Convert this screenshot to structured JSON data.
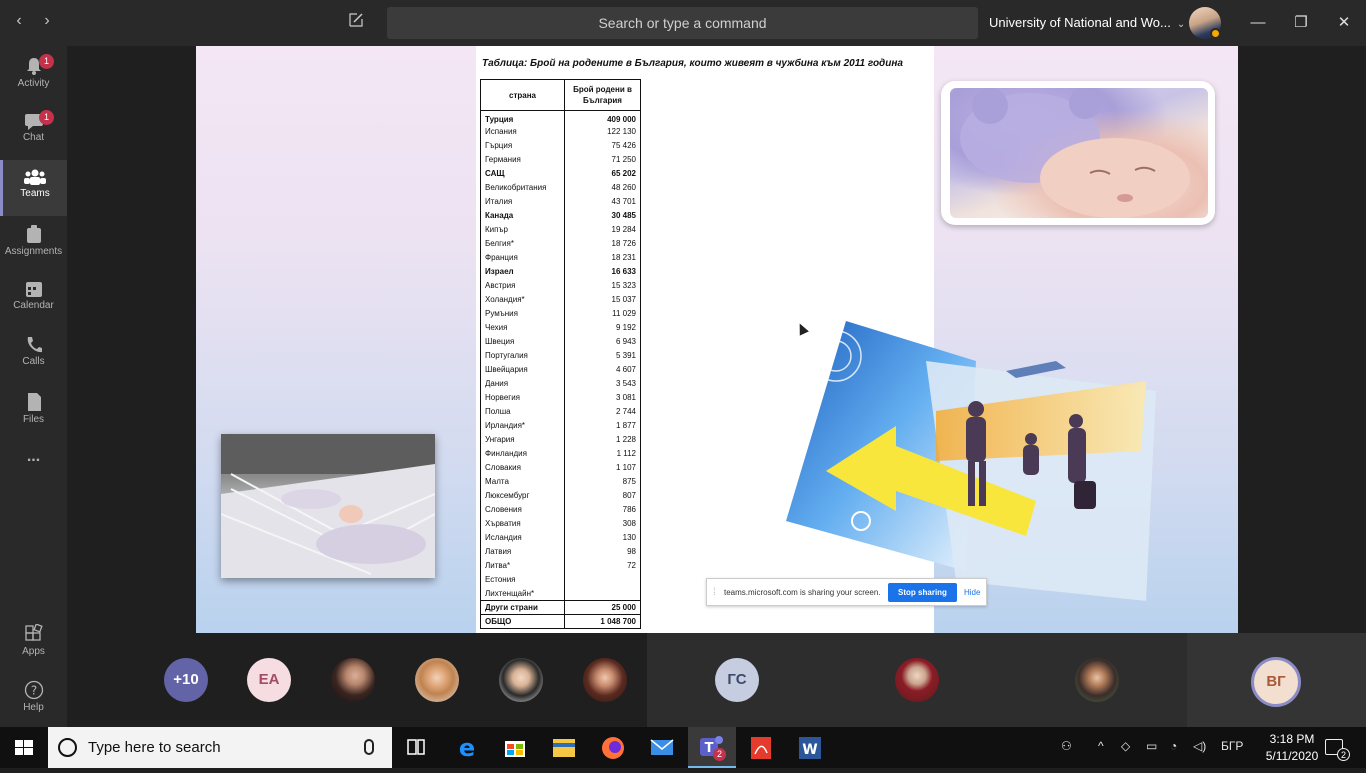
{
  "titlebar": {
    "search_placeholder": "Search or type a command",
    "org_name": "University of National and Wo...",
    "back_label": "‹",
    "forward_label": "›"
  },
  "rail": {
    "items": [
      {
        "label": "Activity",
        "badge": "1"
      },
      {
        "label": "Chat",
        "badge": "1"
      },
      {
        "label": "Teams",
        "badge": ""
      },
      {
        "label": "Assignments",
        "badge": ""
      },
      {
        "label": "Calendar",
        "badge": ""
      },
      {
        "label": "Calls",
        "badge": ""
      },
      {
        "label": "Files",
        "badge": ""
      },
      {
        "label": "...",
        "badge": ""
      },
      {
        "label": "Apps",
        "badge": ""
      },
      {
        "label": "Help",
        "badge": ""
      }
    ]
  },
  "slide": {
    "table_title": "Таблица: Брой на родените в България, които живеят в чужбина към 2011 година",
    "col_country": "страна",
    "col_count": "Брой родени в България",
    "rows": [
      {
        "country": "Турция",
        "count": "409 000",
        "bold": true
      },
      {
        "country": "Испания",
        "count": "122 130",
        "bold": false
      },
      {
        "country": "Гърция",
        "count": "75 426",
        "bold": false
      },
      {
        "country": "Германия",
        "count": "71 250",
        "bold": false
      },
      {
        "country": "САЩ",
        "count": "65 202",
        "bold": true
      },
      {
        "country": "Великобритания",
        "count": "48 260",
        "bold": false
      },
      {
        "country": "Италия",
        "count": "43 701",
        "bold": false
      },
      {
        "country": "Канада",
        "count": "30 485",
        "bold": true
      },
      {
        "country": "Кипър",
        "count": "19 284",
        "bold": false
      },
      {
        "country": "Белгия*",
        "count": "18 726",
        "bold": false
      },
      {
        "country": "Франция",
        "count": "18 231",
        "bold": false
      },
      {
        "country": "Израел",
        "count": "16 633",
        "bold": true
      },
      {
        "country": "Австрия",
        "count": "15 323",
        "bold": false
      },
      {
        "country": "Холандия*",
        "count": "15 037",
        "bold": false
      },
      {
        "country": "Румъния",
        "count": "11 029",
        "bold": false
      },
      {
        "country": "Чехия",
        "count": "9 192",
        "bold": false
      },
      {
        "country": "Швеция",
        "count": "6 943",
        "bold": false
      },
      {
        "country": "Португалия",
        "count": "5 391",
        "bold": false
      },
      {
        "country": "Швейцария",
        "count": "4 607",
        "bold": false
      },
      {
        "country": "Дания",
        "count": "3 543",
        "bold": false
      },
      {
        "country": "Норвегия",
        "count": "3 081",
        "bold": false
      },
      {
        "country": "Полша",
        "count": "2 744",
        "bold": false
      },
      {
        "country": "Ирландия*",
        "count": "1 877",
        "bold": false
      },
      {
        "country": "Унгария",
        "count": "1 228",
        "bold": false
      },
      {
        "country": "Финландия",
        "count": "1 112",
        "bold": false
      },
      {
        "country": "Словакия",
        "count": "1 107",
        "bold": false
      },
      {
        "country": "Малта",
        "count": "875",
        "bold": false
      },
      {
        "country": "Люксембург",
        "count": "807",
        "bold": false
      },
      {
        "country": "Словения",
        "count": "786",
        "bold": false
      },
      {
        "country": "Хърватия",
        "count": "308",
        "bold": false
      },
      {
        "country": "Исландия",
        "count": "130",
        "bold": false
      },
      {
        "country": "Латвия",
        "count": "98",
        "bold": false
      },
      {
        "country": "Литва*",
        "count": "72",
        "bold": false
      },
      {
        "country": "Естония",
        "count": "",
        "bold": false
      },
      {
        "country": "Лихтенщайн*",
        "count": "",
        "bold": false
      },
      {
        "country": "Други страни",
        "count": "25 000",
        "bold": true
      },
      {
        "country": "ОБЩО",
        "count": "1 048 700",
        "bold": true
      }
    ]
  },
  "share_bar": {
    "message": "teams.microsoft.com is sharing your screen.",
    "stop_label": "Stop sharing",
    "hide_label": "Hide"
  },
  "participants": {
    "more_count": "+10",
    "initials_1": "ЕА",
    "initials_2": "ГС",
    "initials_3": "ВГ",
    "more_color": "#6264a7",
    "ea_color": "#f6dde2",
    "gs_color": "#c6cde0",
    "vg_color": "#f3dfd0"
  },
  "taskbar": {
    "search_placeholder": "Type here to search",
    "teams_badge": "2",
    "lang": "БГР",
    "time": "3:18 PM",
    "date": "5/11/2020",
    "notif_count": "2"
  }
}
